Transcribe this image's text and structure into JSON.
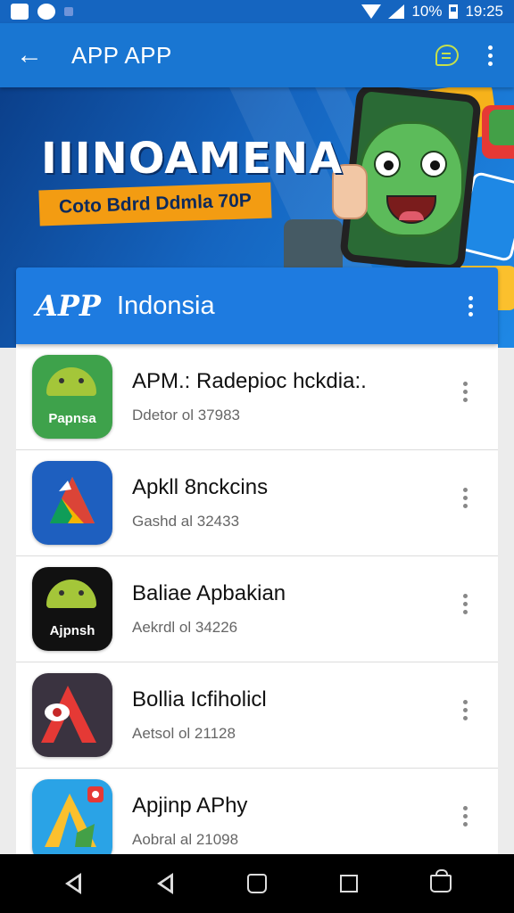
{
  "status_bar": {
    "battery": "10%",
    "time": "19:25"
  },
  "app_bar": {
    "title": "APP APP",
    "back_icon": "arrow-left-icon",
    "chat_icon": "chat-search-icon",
    "menu_icon": "more-vert-icon"
  },
  "banner": {
    "title": "IIINOAMENA",
    "tagline": "Coto Bdrd Ddmla 70P"
  },
  "card": {
    "logo": "APP",
    "title": "Indonsia"
  },
  "apps": [
    {
      "name": "APM.: Radepioc hckdia:.",
      "sub": "Ddetor ol 37983",
      "icon": "android-icon",
      "icon_label": "Papnsa",
      "icon_color": "#3ea24b"
    },
    {
      "name": "Apkll 8nckcins",
      "sub": "Gashd al 32433",
      "icon": "google-drive-icon",
      "icon_label": "",
      "icon_color": "#1e5fbf"
    },
    {
      "name": "Baliae Apbakian",
      "sub": "Aekrdl ol 34226",
      "icon": "android-icon",
      "icon_label": "Ajpnsh",
      "icon_color": "#111111"
    },
    {
      "name": "Bollia Icfiholicl",
      "sub": "Aetsol ol 21128",
      "icon": "red-a-logo-icon",
      "icon_label": "",
      "icon_color": "#3a3340"
    },
    {
      "name": "Apjinp APhy",
      "sub": "Aobral al 21098",
      "icon": "drive-triangle-icon",
      "icon_label": "",
      "icon_color": "#2aa3e6"
    }
  ],
  "nav_bar": {
    "buttons": [
      "back-icon",
      "back-icon",
      "home-icon",
      "recents-icon",
      "shopping-bag-icon"
    ]
  }
}
